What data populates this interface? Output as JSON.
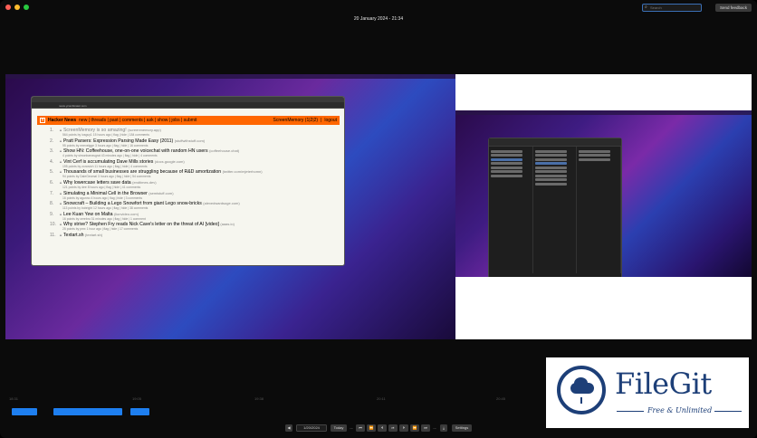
{
  "window": {
    "traffic_lights": [
      "#ff5f57",
      "#febc2e",
      "#28c840"
    ],
    "title": "20 January 2024 - 21:34"
  },
  "toolbar": {
    "search_placeholder": "Search",
    "send_feedback": "Send feedback"
  },
  "browser": {
    "url": "news.ycombinator.com",
    "hn": {
      "logo": "Y",
      "brand": "Hacker News",
      "nav": "new | threads | past | comments | ask | show | jobs | submit",
      "user": "ScreenMemory (1|2|2)",
      "logout": "logout",
      "items": [
        {
          "rank": "1.",
          "title": "ScreenMemory is so amazing!",
          "site": "(screenmemory.app)",
          "sub": "564 points by iosguy1 15 hours ago | flag | hide | 184 comments",
          "muted": true
        },
        {
          "rank": "2.",
          "title": "Pratt Parsers: Expression Parsing Made Easy (2011)",
          "site": "(stuffwithstuff.com)",
          "sub": "95 points by mrevelgge 3 hours ago | flag | hide | 16 comments",
          "muted": false
        },
        {
          "rank": "3.",
          "title": "Show HN: Coffeehouse, one-on-one voicechat with random HN users",
          "site": "(coffeehouse.chat)",
          "sub": "4 points by simonbarrasgrat 43 minutes ago | flag | hide | 4 comments",
          "muted": false
        },
        {
          "rank": "4.",
          "title": "Vint Cerf is accumulating Dave Mills stories",
          "site": "(docs.google.com)",
          "sub": "195 points by zonovich 11 hours ago | flag | hide | 4 comments",
          "muted": false
        },
        {
          "rank": "5.",
          "title": "Thousands of small businesses are struggling because of R&D amortization",
          "site": "(twitter.com/mjeterhomn)",
          "sub": "94 points by DaleGeomal 3 hours ago | flag | hide | 54 comments",
          "muted": false
        },
        {
          "rank": "6.",
          "title": "Why lowercase letters save data",
          "site": "(endtimes.dev)",
          "sub": "121 points by dee 8 hours ago | flag | hide | 41 comments",
          "muted": false
        },
        {
          "rank": "7.",
          "title": "Simulating a Minimal Cell in the Browser",
          "site": "(semistuff.com)",
          "sub": "16 points by agunno 4 hours ago | flag | hide | 3 comments",
          "muted": false
        },
        {
          "rank": "8.",
          "title": "Snowcraft – Building a Lego Snowfort from giant Lego snow-bricks",
          "site": "(alexedwardsoge.com)",
          "sub": "113 points by bobright 12 hours ago | flag | hide | 38 comments",
          "muted": false
        },
        {
          "rank": "9.",
          "title": "Lee Kuan Yew on Malta",
          "site": "(lionvideo.com)",
          "sub": "16 points by cerebro 31 minutes ago | flag | hide | 1 comment",
          "muted": false
        },
        {
          "rank": "10.",
          "title": "Why strive? Stephen Fry reads Nick Cave's letter on the threat of AI [video]",
          "site": "(aaas.io)",
          "sub": "25 points by pmx 1 hour ago | flag | hide | 17 comments",
          "muted": false
        },
        {
          "rank": "11.",
          "title": "Textart.sh",
          "site": "(textart.sh)",
          "sub": "",
          "muted": false
        }
      ]
    }
  },
  "timeline": {
    "ticks": [
      "18:31",
      "19:05",
      "19:38",
      "20:11",
      "20:45",
      "21:18"
    ],
    "segments": [
      {
        "start_min": 0,
        "end_min": 12
      },
      {
        "start_min": 20,
        "end_min": 53
      },
      {
        "start_min": 57,
        "end_min": 66
      }
    ]
  },
  "controls": {
    "prev": "◀",
    "date": "1/20/2024",
    "next": "▶",
    "today": "Today",
    "skip_back": "⏮",
    "rewind": "⏪",
    "step_back": "⏴",
    "play": "⏯",
    "step_fwd": "⏵",
    "fast_fwd": "⏩",
    "skip_fwd": "⏭",
    "dots_left": "...",
    "dots_right": "...",
    "export": "⤓",
    "settings": "Settings"
  },
  "watermark": {
    "brand": "FileGit",
    "tagline": "Free & Unlimited",
    "color": "#1d3f78"
  }
}
